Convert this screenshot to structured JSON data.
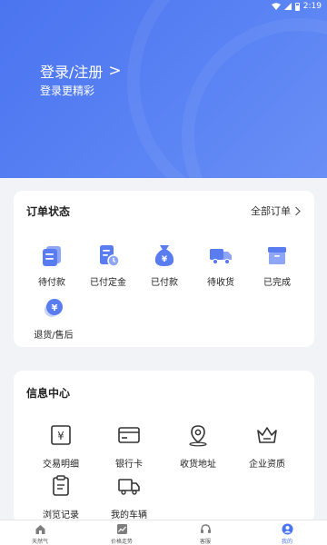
{
  "status_bar": {
    "time": "2:19"
  },
  "header": {
    "login_label": "登录/注册",
    "subtitle": "登录更精彩"
  },
  "orders": {
    "title": "订单状态",
    "all_label": "全部订单",
    "items": [
      {
        "label": "待付款",
        "icon": "pending-payment-icon"
      },
      {
        "label": "已付定金",
        "icon": "deposit-paid-icon"
      },
      {
        "label": "已付款",
        "icon": "money-bag-icon"
      },
      {
        "label": "待收货",
        "icon": "truck-icon"
      },
      {
        "label": "已完成",
        "icon": "box-icon"
      },
      {
        "label": "退货/售后",
        "icon": "refund-icon"
      }
    ]
  },
  "info": {
    "title": "信息中心",
    "items": [
      {
        "label": "交易明细",
        "icon": "yuan-receipt-icon"
      },
      {
        "label": "银行卡",
        "icon": "bank-card-icon"
      },
      {
        "label": "收货地址",
        "icon": "location-pin-icon"
      },
      {
        "label": "企业资质",
        "icon": "crown-icon"
      },
      {
        "label": "浏览记录",
        "icon": "clipboard-icon"
      },
      {
        "label": "我的车辆",
        "icon": "vehicle-icon"
      }
    ]
  },
  "tabbar": {
    "items": [
      {
        "label": "天然气",
        "icon": "home-icon"
      },
      {
        "label": "价格走势",
        "icon": "trend-icon"
      },
      {
        "label": "客服",
        "icon": "headset-icon"
      },
      {
        "label": "我的",
        "icon": "user-icon",
        "active": true
      }
    ]
  },
  "colors": {
    "primary": "#4b74f0",
    "icon_blue": "#5a7cf1",
    "icon_dark": "#5b6ccc",
    "text": "#222222",
    "background": "#f2f3f7"
  }
}
